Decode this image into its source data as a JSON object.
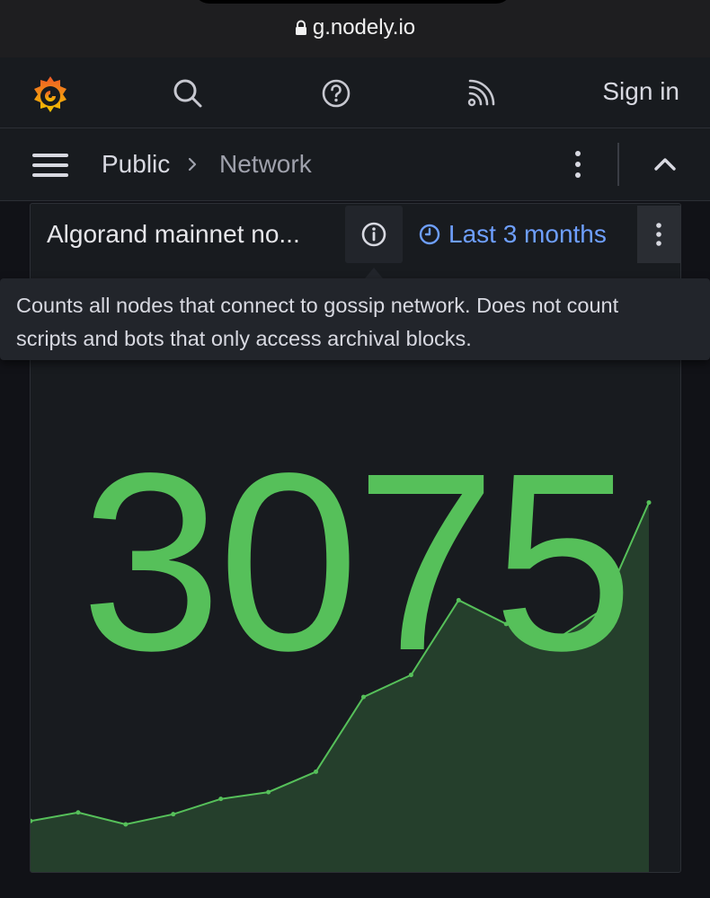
{
  "browser": {
    "url": "g.nodely.io"
  },
  "topnav": {
    "logo_icon": "grafana-logo-icon",
    "search_icon": "search-icon",
    "help_icon": "help-circle-icon",
    "rss_icon": "rss-icon",
    "sign_in_label": "Sign in"
  },
  "breadcrumb": {
    "menu_icon": "hamburger-menu-icon",
    "items": [
      "Public",
      "Network"
    ],
    "more_icon": "kebab-vertical-icon",
    "collapse_icon": "chevron-up-icon"
  },
  "panel": {
    "title": "Algorand mainnet no...",
    "info_icon": "info-circle-icon",
    "time_range": "Last 3 months",
    "time_icon": "clock-icon",
    "menu_icon": "kebab-vertical-icon",
    "tooltip": "Counts all nodes that connect to gossip network. Does not count scripts and bots that only access archival blocks.",
    "value": "3075",
    "color": "#56c05a"
  },
  "chart_data": {
    "type": "area",
    "series": [
      {
        "values": [
          1200,
          1250,
          1180,
          1240,
          1330,
          1370,
          1490,
          1930,
          2060,
          2500,
          2360,
          2260,
          2440,
          3075
        ]
      }
    ],
    "ylim": [
      900,
      3300
    ],
    "grid": false
  }
}
